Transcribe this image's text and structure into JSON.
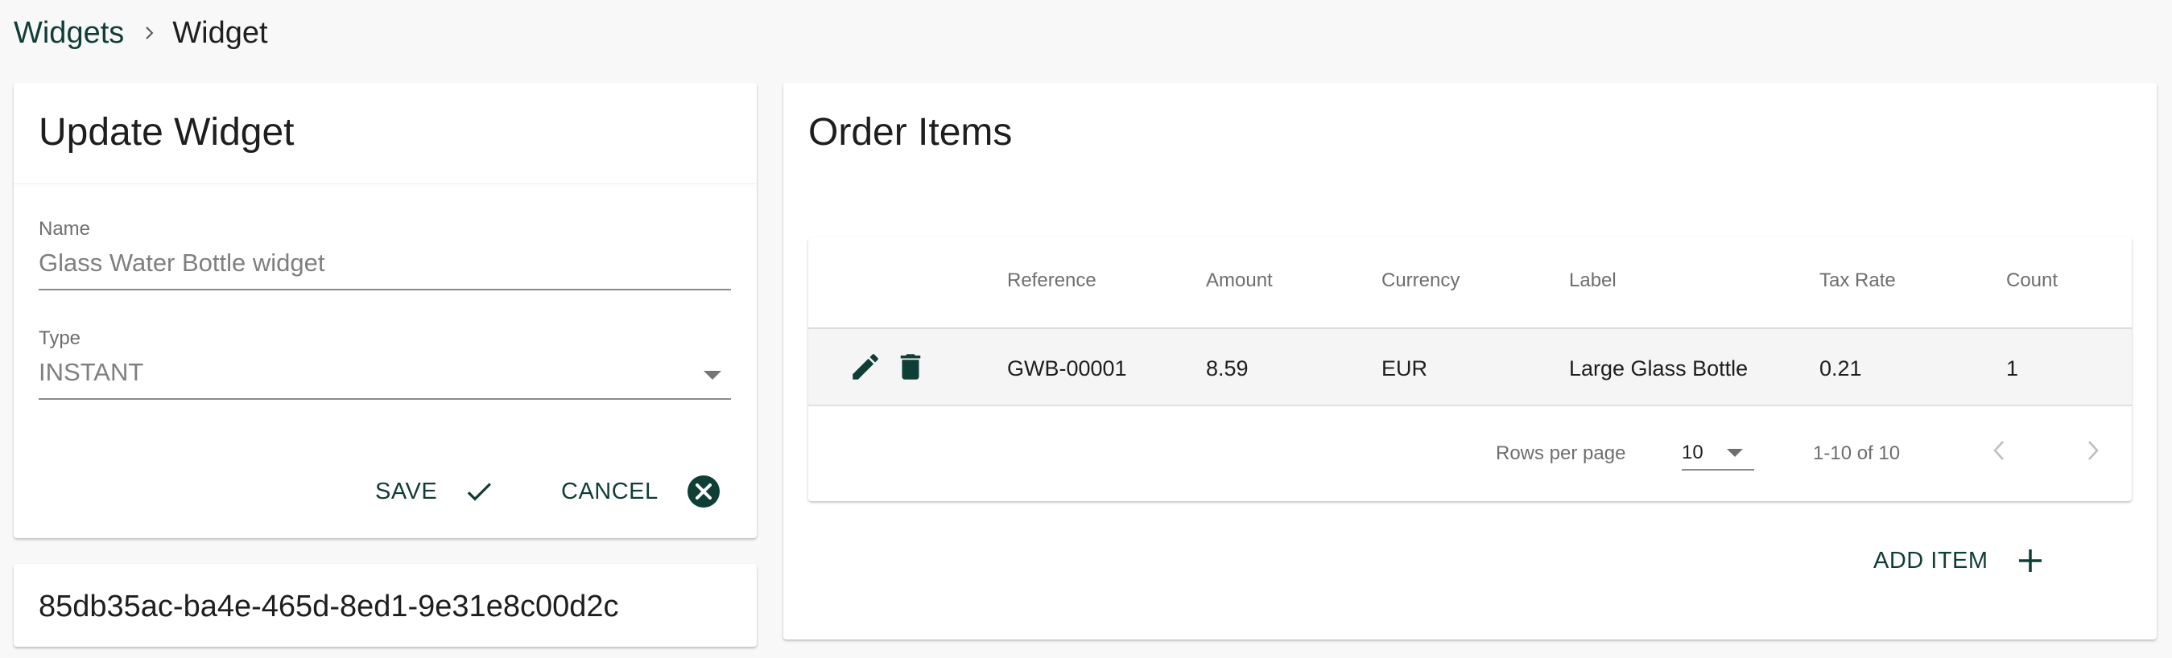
{
  "breadcrumb": {
    "parent": "Widgets",
    "current": "Widget"
  },
  "update_form": {
    "title": "Update Widget",
    "name_label": "Name",
    "name_value": "Glass Water Bottle widget",
    "type_label": "Type",
    "type_value": "INSTANT",
    "save_label": "SAVE",
    "cancel_label": "CANCEL"
  },
  "widget_id": "85db35ac-ba4e-465d-8ed1-9e31e8c00d2c",
  "order_items": {
    "title": "Order Items",
    "columns": [
      "Reference",
      "Amount",
      "Currency",
      "Label",
      "Tax Rate",
      "Count"
    ],
    "rows": [
      {
        "reference": "GWB-00001",
        "amount": "8.59",
        "currency": "EUR",
        "label": "Large Glass Bottle",
        "tax_rate": "0.21",
        "count": "1"
      }
    ],
    "pagination": {
      "rows_per_page_label": "Rows per page",
      "rows_per_page": "10",
      "range": "1-10 of 10"
    },
    "add_item_label": "ADD ITEM"
  },
  "icons": {
    "breadcrumb_separator": "chevron-right-icon",
    "save": "check-icon",
    "cancel": "close-circle-icon",
    "edit": "pencil-icon",
    "delete": "trash-icon",
    "prev_page": "chevron-left-icon",
    "next_page": "chevron-right-icon",
    "add": "plus-icon"
  },
  "colors": {
    "accent": "#0f3e36",
    "background": "#f8f8f8",
    "card": "#ffffff"
  }
}
